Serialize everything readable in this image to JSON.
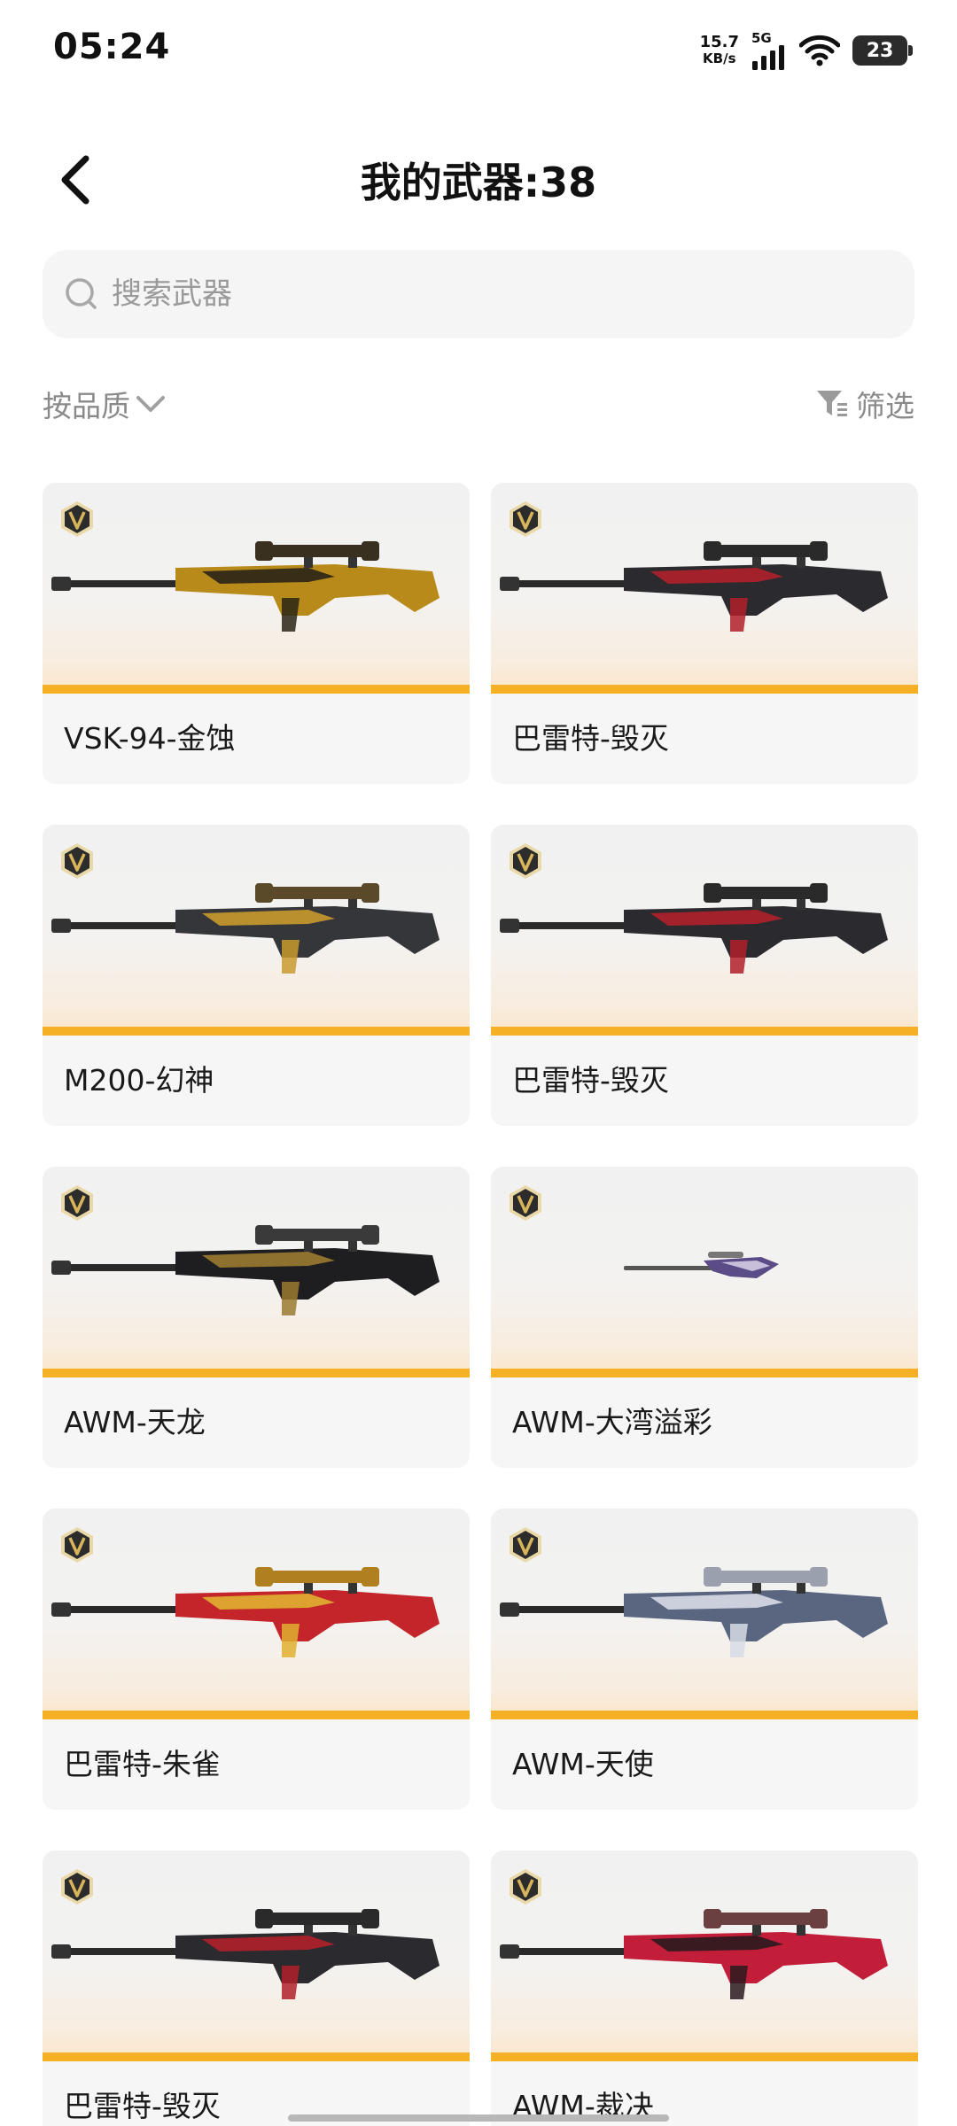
{
  "status_bar": {
    "time": "05:24",
    "net_speed_value": "15.7",
    "net_speed_unit": "KB/s",
    "network_type": "5G",
    "battery_level": "23"
  },
  "header": {
    "back_icon": "chevron-left-icon",
    "title": "我的武器:38"
  },
  "search": {
    "placeholder": "搜索武器",
    "value": ""
  },
  "filters": {
    "sort_label": "按品质",
    "filter_label": "筛选"
  },
  "colors": {
    "accent_stripe": "#f6b025",
    "badge_gold": "#caa14a"
  },
  "weapons": [
    {
      "name": "VSK-94-金蚀",
      "style": "gold"
    },
    {
      "name": "巴雷特-毁灭",
      "style": "dark-red"
    },
    {
      "name": "M200-幻神",
      "style": "dark-gold"
    },
    {
      "name": "巴雷特-毁灭",
      "style": "dark-red"
    },
    {
      "name": "AWM-天龙",
      "style": "black-gold"
    },
    {
      "name": "AWM-大湾溢彩",
      "style": "purple-small"
    },
    {
      "name": "巴雷特-朱雀",
      "style": "red-gold"
    },
    {
      "name": "AWM-天使",
      "style": "silver-blue"
    },
    {
      "name": "巴雷特-毁灭",
      "style": "dark-red"
    },
    {
      "name": "AWM-裁决",
      "style": "red-black"
    }
  ]
}
